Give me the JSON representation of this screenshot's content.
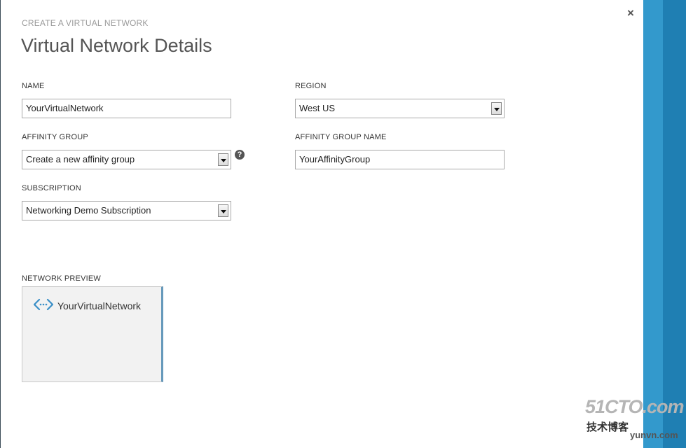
{
  "header": {
    "eyebrow": "CREATE A VIRTUAL NETWORK",
    "title": "Virtual Network Details",
    "close_glyph": "×"
  },
  "form": {
    "name": {
      "label": "NAME",
      "value": "YourVirtualNetwork"
    },
    "region": {
      "label": "REGION",
      "value": "West US"
    },
    "affinity_group": {
      "label": "AFFINITY GROUP",
      "value": "Create a new affinity group",
      "help_glyph": "?"
    },
    "affinity_group_name": {
      "label": "AFFINITY GROUP NAME",
      "value": "YourAffinityGroup"
    },
    "subscription": {
      "label": "SUBSCRIPTION",
      "value": "Networking Demo Subscription"
    }
  },
  "preview": {
    "label": "NETWORK PREVIEW",
    "network_name": "YourVirtualNetwork",
    "icon": "virtual-network-icon"
  },
  "watermark": {
    "line1": "51CTO.com",
    "line2": "技术博客",
    "line3": "yunvn.com"
  },
  "colors": {
    "sidebar": "#3399cc",
    "sidebar_stripe": "#1f7fb3",
    "preview_accent": "#6699bb",
    "icon_blue": "#3a8fc7"
  }
}
